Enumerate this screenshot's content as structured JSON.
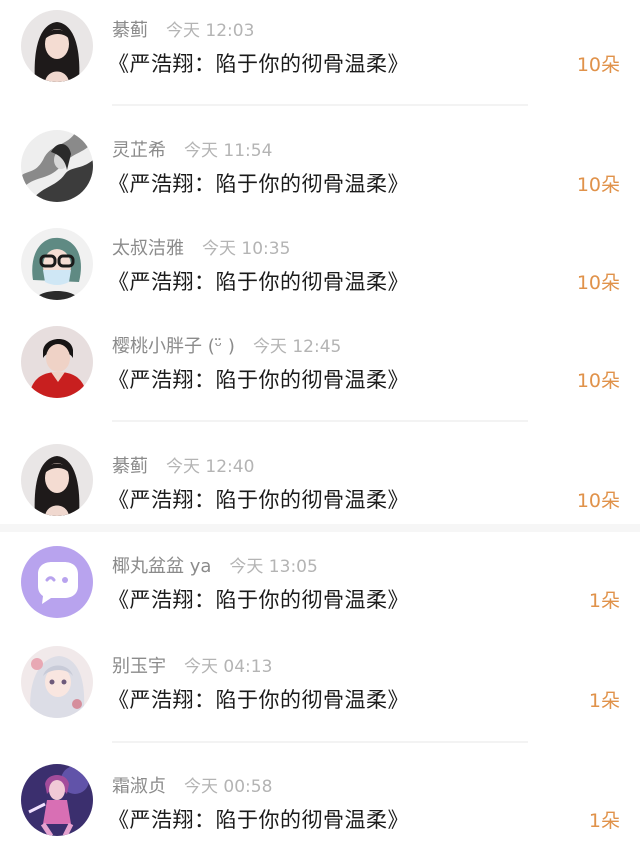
{
  "colors": {
    "username": "#8b8b8b",
    "timestamp": "#b4b4b4",
    "message": "#1b1b1b",
    "gift_count": "#e0924a",
    "divider": "#f3f3f3"
  },
  "comments": [
    {
      "username": "綦蓟",
      "time": "今天 12:03",
      "message": "《严浩翔：陷于你的彻骨温柔》",
      "gift": "10朵",
      "avatar": "girl-long-hair-avatar"
    },
    {
      "username": "灵芷希",
      "time": "今天 11:54",
      "message": "《严浩翔：陷于你的彻骨温柔》",
      "gift": "10朵",
      "avatar": "ink-painting-avatar"
    },
    {
      "username": "太叔洁雅",
      "time": "今天 10:35",
      "message": "《严浩翔：陷于你的彻骨温柔》",
      "gift": "10朵",
      "avatar": "masked-girl-green-hair-avatar"
    },
    {
      "username": "樱桃小胖子 (ᵕ̈ )",
      "time": "今天 12:45",
      "message": "《严浩翔：陷于你的彻骨温柔》",
      "gift": "10朵",
      "avatar": "boy-red-shirt-avatar"
    },
    {
      "username": "綦蓟",
      "time": "今天 12:40",
      "message": "《严浩翔：陷于你的彻骨温柔》",
      "gift": "10朵",
      "avatar": "girl-long-hair-avatar"
    },
    {
      "username": "椰丸盆盆 ya",
      "time": "今天 13:05",
      "message": "《严浩翔：陷于你的彻骨温柔》",
      "gift": "1朵",
      "avatar": "default-chat-bubble-avatar"
    },
    {
      "username": "别玉宇",
      "time": "今天 04:13",
      "message": "《严浩翔：陷于你的彻骨温柔》",
      "gift": "1朵",
      "avatar": "anime-girl-avatar"
    },
    {
      "username": "霜淑贞",
      "time": "今天 00:58",
      "message": "《严浩翔：陷于你的彻骨温柔》",
      "gift": "1朵",
      "avatar": "game-character-avatar"
    }
  ]
}
